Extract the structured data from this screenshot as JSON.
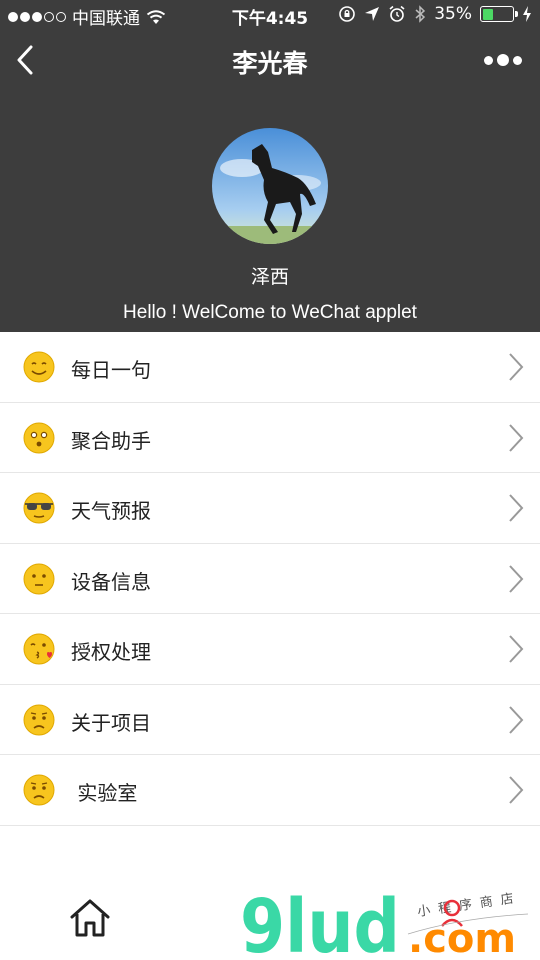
{
  "status_bar": {
    "carrier": "中国联通",
    "time": "下午4:45",
    "battery": "35%",
    "battery_level": 0.35,
    "icons": [
      "signal-dots-icon",
      "wifi-icon",
      "rotation-lock-icon",
      "location-arrow-icon",
      "alarm-icon",
      "bluetooth-icon",
      "charging-icon"
    ]
  },
  "nav": {
    "title": "李光春",
    "icons": [
      "back-chevron-icon",
      "more-dots-icon"
    ]
  },
  "profile": {
    "name": "泽西",
    "greeting": "Hello ! WelCome to WeChat applet",
    "avatar": "horse-photo-avatar"
  },
  "menu": [
    {
      "label": "每日一句",
      "icon": "smiling-face-icon"
    },
    {
      "label": "聚合助手",
      "icon": "surprised-face-icon"
    },
    {
      "label": "天气预报",
      "icon": "sunglasses-face-icon"
    },
    {
      "label": "设备信息",
      "icon": "neutral-face-icon"
    },
    {
      "label": "授权处理",
      "icon": "kissing-face-icon"
    },
    {
      "label": "关于项目",
      "icon": "worried-face-icon"
    },
    {
      "label": " 实验室",
      "icon": "worried-face-icon"
    }
  ],
  "tabbar": {
    "icons": [
      "home-icon"
    ]
  },
  "watermark": {
    "brand": "9lud",
    "domain": ".com",
    "tagline": "小程序商店"
  },
  "colors": {
    "header_bg": "#3d3d3d",
    "emoji_yellow": "#f7c51e",
    "watermark_green": "#3ad8a6",
    "watermark_orange": "#ff8a00"
  }
}
